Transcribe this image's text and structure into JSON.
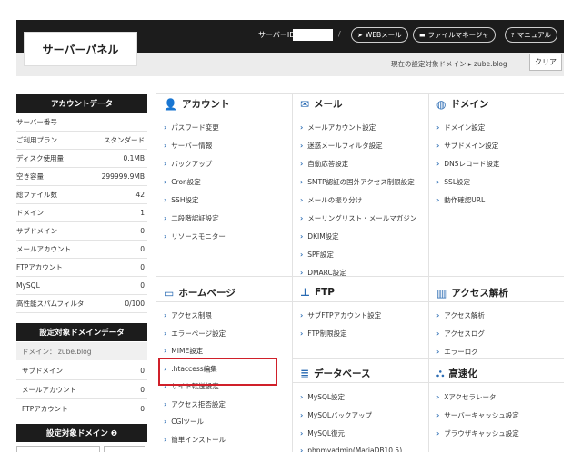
{
  "header": {
    "logo": "サーバーパネル",
    "server_id_label": "サーバーID",
    "slash": "/",
    "buttons": [
      {
        "label": "WEBメール",
        "icon": "send-icon",
        "glyph": "➤"
      },
      {
        "label": "ファイルマネージャ",
        "icon": "folder-icon",
        "glyph": "▬"
      },
      {
        "label": "マニュアル",
        "icon": "help-icon",
        "glyph": "?"
      }
    ],
    "current_target": "現在の設定対象ドメイン ▸ zube.blog",
    "clear_label": "クリア"
  },
  "sidebar": {
    "account_title": "アカウントデータ",
    "account_rows": [
      {
        "label": "サーバー番号",
        "value": ""
      },
      {
        "label": "ご利用プラン",
        "value": "スタンダード"
      },
      {
        "label": "ディスク使用量",
        "value": "0.1MB"
      },
      {
        "label": "空き容量",
        "value": "299999.9MB"
      },
      {
        "label": "総ファイル数",
        "value": "42"
      },
      {
        "label": "ドメイン",
        "value": "1"
      },
      {
        "label": "サブドメイン",
        "value": "0"
      },
      {
        "label": "メールアカウント",
        "value": "0"
      },
      {
        "label": "FTPアカウント",
        "value": "0"
      },
      {
        "label": "MySQL",
        "value": "0"
      },
      {
        "label": "高性能スパムフィルタ",
        "value": "0/100"
      }
    ],
    "target_title": "設定対象ドメインデータ",
    "target_domain": "ドメイン： zube.blog",
    "target_rows": [
      {
        "label": "サブドメイン",
        "value": "0"
      },
      {
        "label": "メールアカウント",
        "value": "0"
      },
      {
        "label": "FTPアカウント",
        "value": "0"
      }
    ],
    "target_select_title": "設定対象ドメイン ❷"
  },
  "sections": {
    "account": {
      "title": "アカウント",
      "items": [
        "パスワード変更",
        "サーバー情報",
        "バックアップ",
        "Cron設定",
        "SSH設定",
        "二段階認証設定",
        "リソースモニター"
      ]
    },
    "mail": {
      "title": "メール",
      "items": [
        "メールアカウント設定",
        "迷惑メールフィルタ設定",
        "自動応答設定",
        "SMTP認証の国外アクセス制限設定",
        "メールの振り分け",
        "メーリングリスト・メールマガジン",
        "DKIM設定",
        "SPF設定",
        "DMARC設定"
      ]
    },
    "domain": {
      "title": "ドメイン",
      "items": [
        "ドメイン設定",
        "サブドメイン設定",
        "DNSレコード設定",
        "SSL設定",
        "動作確認URL"
      ]
    },
    "homepage": {
      "title": "ホームページ",
      "items": [
        "アクセス制限",
        "エラーページ設定",
        "MIME設定",
        ".htaccess編集",
        "サイト転送設定",
        "アクセス拒否設定",
        "CGIツール",
        "簡単インストール"
      ]
    },
    "ftp": {
      "title": "FTP",
      "items": [
        "サブFTPアカウント設定",
        "FTP制限設定"
      ]
    },
    "access": {
      "title": "アクセス解析",
      "items": [
        "アクセス解析",
        "アクセスログ",
        "エラーログ"
      ]
    },
    "database": {
      "title": "データベース",
      "items": [
        "MySQL設定",
        "MySQLバックアップ",
        "MySQL復元",
        "phpmyadmin(MariaDB10.5)"
      ]
    },
    "speed": {
      "title": "高速化",
      "items": [
        "Xアクセラレータ",
        "サーバーキャッシュ設定",
        "ブラウザキャッシュ設定"
      ]
    }
  },
  "icons": {
    "account": "👤",
    "mail": "✉",
    "domain": "◍",
    "homepage": "▭",
    "ftp": "⊥",
    "access": "▥",
    "database": "≣",
    "speed": "⛬",
    "chevron": "›",
    "cursor": "☝"
  }
}
